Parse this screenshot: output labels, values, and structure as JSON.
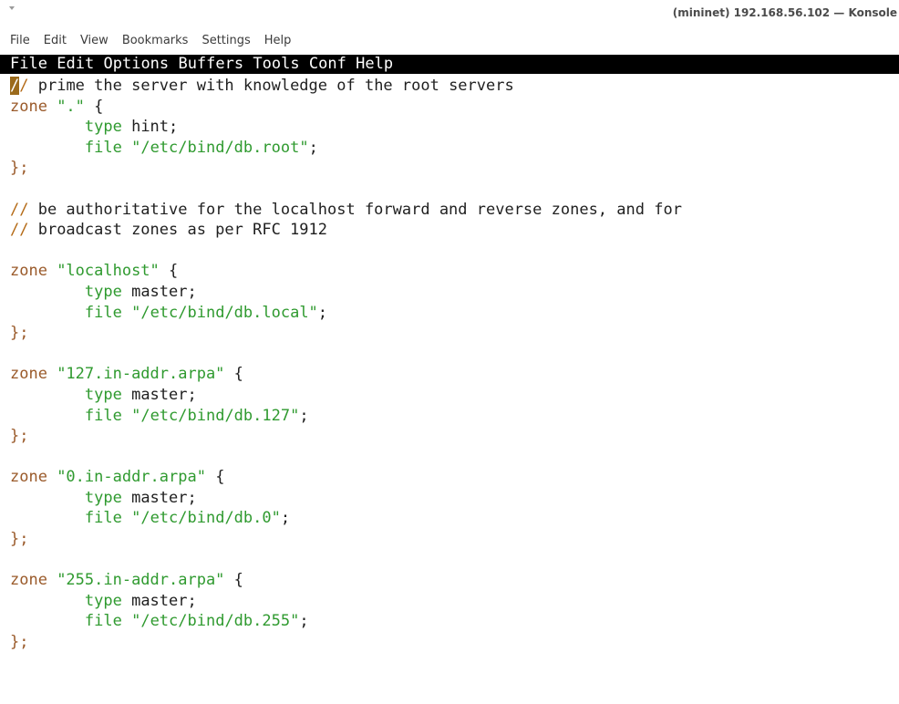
{
  "window": {
    "title": "(mininet) 192.168.56.102 — Konsole"
  },
  "konsole_menu": [
    "File",
    "Edit",
    "View",
    "Bookmarks",
    "Settings",
    "Help"
  ],
  "emacs_menu": [
    "File",
    "Edit",
    "Options",
    "Buffers",
    "Tools",
    "Conf",
    "Help"
  ],
  "colors": {
    "comment_delimiter": "#b46a16",
    "keyword": "#9a5a2a",
    "string": "#2f9a2f",
    "cursor": "#9b6a1b",
    "emacs_menubar_bg": "#000000"
  },
  "editor": {
    "lines": [
      [
        {
          "t": "/",
          "s": "cursor"
        },
        {
          "t": "/",
          "s": "c-comment-delim"
        },
        {
          "t": " prime the server with knowledge of the root servers",
          "s": ""
        }
      ],
      [
        {
          "t": "zone ",
          "s": "c-kw"
        },
        {
          "t": "\".\"",
          "s": "c-str"
        },
        {
          "t": " {",
          "s": ""
        }
      ],
      [
        {
          "t": "        ",
          "s": ""
        },
        {
          "t": "type",
          "s": "c-type"
        },
        {
          "t": " hint;",
          "s": ""
        }
      ],
      [
        {
          "t": "        ",
          "s": ""
        },
        {
          "t": "file",
          "s": "c-type"
        },
        {
          "t": " ",
          "s": ""
        },
        {
          "t": "\"/etc/bind/db.root\"",
          "s": "c-str"
        },
        {
          "t": ";",
          "s": ""
        }
      ],
      [
        {
          "t": "};",
          "s": "c-punct"
        }
      ],
      [
        {
          "t": "",
          "s": ""
        }
      ],
      [
        {
          "t": "//",
          "s": "c-comment-delim"
        },
        {
          "t": " be authoritative for the localhost forward and reverse zones, and for",
          "s": ""
        }
      ],
      [
        {
          "t": "//",
          "s": "c-comment-delim"
        },
        {
          "t": " broadcast zones as per RFC 1912",
          "s": ""
        }
      ],
      [
        {
          "t": "",
          "s": ""
        }
      ],
      [
        {
          "t": "zone ",
          "s": "c-kw"
        },
        {
          "t": "\"localhost\"",
          "s": "c-str"
        },
        {
          "t": " {",
          "s": ""
        }
      ],
      [
        {
          "t": "        ",
          "s": ""
        },
        {
          "t": "type",
          "s": "c-type"
        },
        {
          "t": " master;",
          "s": ""
        }
      ],
      [
        {
          "t": "        ",
          "s": ""
        },
        {
          "t": "file",
          "s": "c-type"
        },
        {
          "t": " ",
          "s": ""
        },
        {
          "t": "\"/etc/bind/db.local\"",
          "s": "c-str"
        },
        {
          "t": ";",
          "s": ""
        }
      ],
      [
        {
          "t": "};",
          "s": "c-punct"
        }
      ],
      [
        {
          "t": "",
          "s": ""
        }
      ],
      [
        {
          "t": "zone ",
          "s": "c-kw"
        },
        {
          "t": "\"127.in-addr.arpa\"",
          "s": "c-str"
        },
        {
          "t": " {",
          "s": ""
        }
      ],
      [
        {
          "t": "        ",
          "s": ""
        },
        {
          "t": "type",
          "s": "c-type"
        },
        {
          "t": " master;",
          "s": ""
        }
      ],
      [
        {
          "t": "        ",
          "s": ""
        },
        {
          "t": "file",
          "s": "c-type"
        },
        {
          "t": " ",
          "s": ""
        },
        {
          "t": "\"/etc/bind/db.127\"",
          "s": "c-str"
        },
        {
          "t": ";",
          "s": ""
        }
      ],
      [
        {
          "t": "};",
          "s": "c-punct"
        }
      ],
      [
        {
          "t": "",
          "s": ""
        }
      ],
      [
        {
          "t": "zone ",
          "s": "c-kw"
        },
        {
          "t": "\"0.in-addr.arpa\"",
          "s": "c-str"
        },
        {
          "t": " {",
          "s": ""
        }
      ],
      [
        {
          "t": "        ",
          "s": ""
        },
        {
          "t": "type",
          "s": "c-type"
        },
        {
          "t": " master;",
          "s": ""
        }
      ],
      [
        {
          "t": "        ",
          "s": ""
        },
        {
          "t": "file",
          "s": "c-type"
        },
        {
          "t": " ",
          "s": ""
        },
        {
          "t": "\"/etc/bind/db.0\"",
          "s": "c-str"
        },
        {
          "t": ";",
          "s": ""
        }
      ],
      [
        {
          "t": "};",
          "s": "c-punct"
        }
      ],
      [
        {
          "t": "",
          "s": ""
        }
      ],
      [
        {
          "t": "zone ",
          "s": "c-kw"
        },
        {
          "t": "\"255.in-addr.arpa\"",
          "s": "c-str"
        },
        {
          "t": " {",
          "s": ""
        }
      ],
      [
        {
          "t": "        ",
          "s": ""
        },
        {
          "t": "type",
          "s": "c-type"
        },
        {
          "t": " master;",
          "s": ""
        }
      ],
      [
        {
          "t": "        ",
          "s": ""
        },
        {
          "t": "file",
          "s": "c-type"
        },
        {
          "t": " ",
          "s": ""
        },
        {
          "t": "\"/etc/bind/db.255\"",
          "s": "c-str"
        },
        {
          "t": ";",
          "s": ""
        }
      ],
      [
        {
          "t": "};",
          "s": "c-punct"
        }
      ]
    ]
  }
}
